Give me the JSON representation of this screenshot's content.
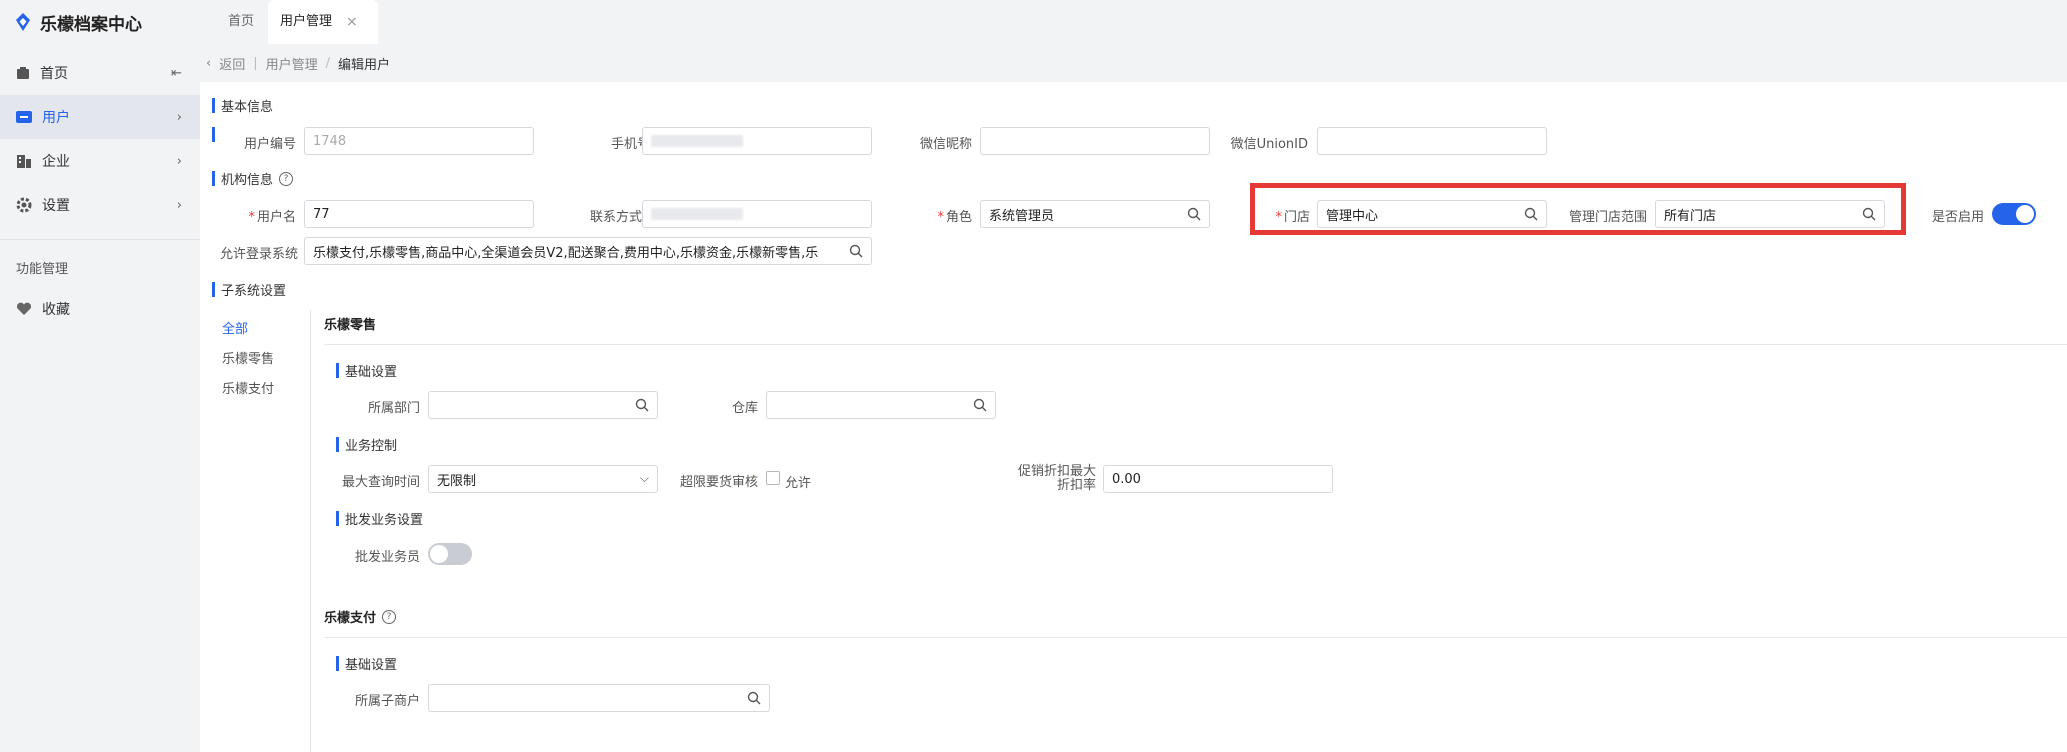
{
  "app": {
    "title": "乐檬档案中心"
  },
  "tabs": [
    {
      "label": "首页"
    },
    {
      "label": "用户管理",
      "close": "×"
    }
  ],
  "sidebar": {
    "items": [
      {
        "label": "首页",
        "icon": "home-icon"
      },
      {
        "label": "用户",
        "icon": "user-card-icon"
      },
      {
        "label": "企业",
        "icon": "building-icon"
      },
      {
        "label": "设置",
        "icon": "gear-icon"
      }
    ],
    "section": "功能管理",
    "favorites": "收藏"
  },
  "breadcrumb": {
    "back": "返回",
    "parent": "用户管理",
    "sep": "/",
    "current": "编辑用户"
  },
  "basic": {
    "title": "基本信息",
    "user_no_label": "用户编号",
    "user_no": "1748",
    "phone_label": "手机号",
    "wechat_nick_label": "微信昵称",
    "wechat_union_label": "微信UnionID"
  },
  "org": {
    "title": "机构信息",
    "username_label": "用户名",
    "username": "77",
    "contact_label": "联系方式",
    "role_label": "角色",
    "role": "系统管理员",
    "store_label": "门店",
    "store": "管理中心",
    "store_range_label": "管理门店范围",
    "store_range": "所有门店",
    "enabled_label": "是否启用",
    "login_sys_label": "允许登录系统",
    "login_sys": "乐檬支付,乐檬零售,商品中心,全渠道会员V2,配送聚合,费用中心,乐檬资金,乐檬新零售,乐"
  },
  "sub": {
    "title": "子系统设置",
    "nav": [
      "全部",
      "乐檬零售",
      "乐檬支付"
    ],
    "retail": {
      "title": "乐檬零售",
      "basic_title": "基础设置",
      "dept_label": "所属部门",
      "warehouse_label": "仓库",
      "biz_title": "业务控制",
      "max_query_label": "最大查询时间",
      "max_query": "无限制",
      "over_limit_label": "超限要货审核",
      "allow_label": "允许",
      "discount_label_1": "促销折扣最大",
      "discount_label_2": "折扣率",
      "discount": "0.00",
      "wholesale_title": "批发业务设置",
      "wholesale_label": "批发业务员"
    },
    "pay": {
      "title": "乐檬支付",
      "basic_title": "基础设置",
      "merchant_label": "所属子商户"
    }
  },
  "colors": {
    "accent": "#2563eb",
    "highlight": "#e53935"
  }
}
